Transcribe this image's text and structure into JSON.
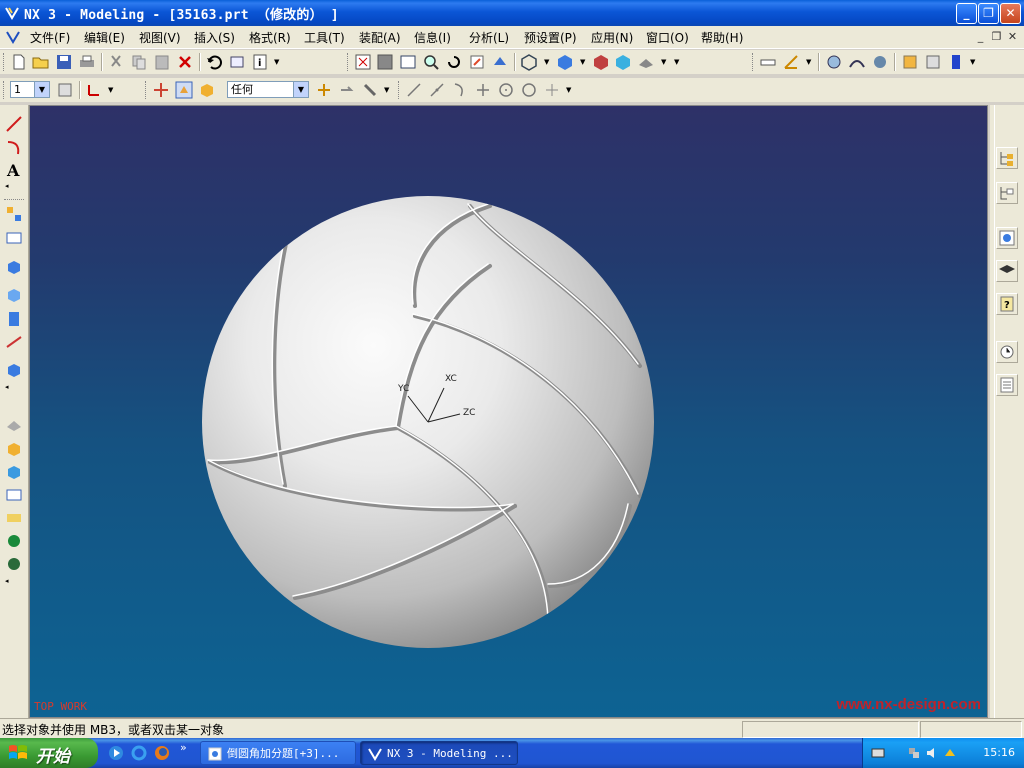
{
  "window": {
    "title": "NX 3 - Modeling - [35163.prt  （修改的） ]",
    "minimize": "_",
    "maximize": "❐",
    "close": "✕"
  },
  "menu": {
    "items": [
      "文件(F)",
      "编辑(E)",
      "视图(V)",
      "插入(S)",
      "格式(R)",
      "工具(T)",
      "装配(A)",
      "信息(I)",
      "分析(L)",
      "预设置(P)",
      "应用(N)",
      "窗口(O)",
      "帮助(H)"
    ],
    "mdi": [
      "_",
      "❐",
      "✕"
    ]
  },
  "toolbar2": {
    "layer_value": "1",
    "filter_value": "任何"
  },
  "viewport": {
    "axes": {
      "xc": "XC",
      "yc": "YC",
      "zc": "ZC"
    },
    "view_label": "TOP WORK",
    "watermark": "www.nx-design.com"
  },
  "status": {
    "message": "选择对象并使用 MB3，或者双击某一对象"
  },
  "taskbar": {
    "start_label": "开始",
    "tasks": [
      {
        "label": "倒圆角加分题[+3]..."
      },
      {
        "label": "NX 3 - Modeling ..."
      }
    ],
    "clock": "15:16"
  },
  "colors": {
    "titlebar": "#0a56d6",
    "viewport_top": "#2e3168",
    "viewport_bottom": "#0d6393",
    "start_green": "#3a9a33"
  }
}
